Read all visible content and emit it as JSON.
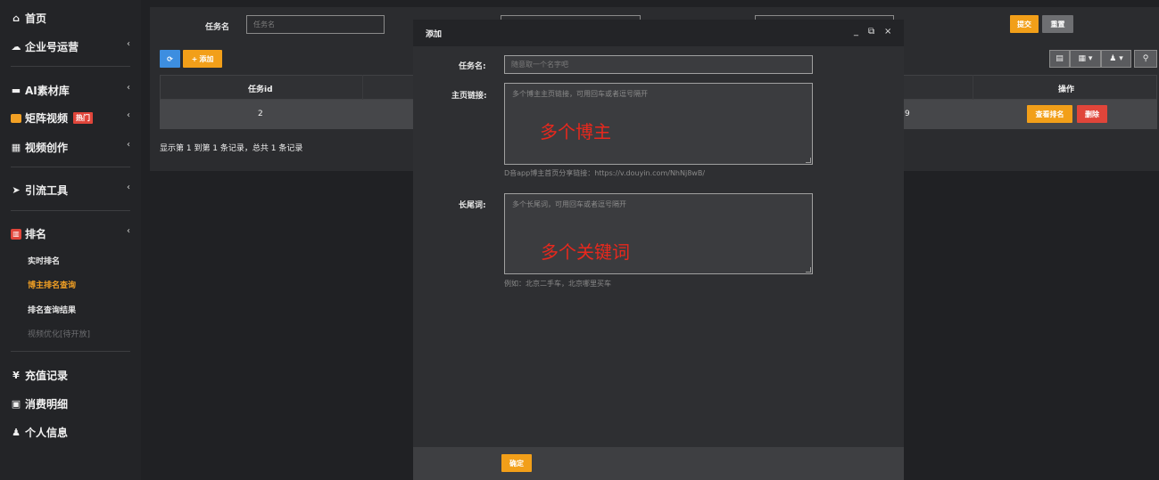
{
  "sidebar": {
    "home": "首页",
    "enterprise": "企业号运营",
    "ai_assets": "AI素材库",
    "matrix_video": "矩阵视频",
    "hot_badge": "热门",
    "video_create": "视频创作",
    "traffic_tools": "引流工具",
    "ranking": "排名",
    "sub_realtime": "实时排名",
    "sub_blogger": "博主排名查询",
    "sub_results": "排名查询结果",
    "sub_optimize": "视频优化[待开放]",
    "recharge": "充值记录",
    "consumption": "消费明细",
    "profile": "个人信息"
  },
  "search": {
    "task_label": "任务名",
    "task_placeholder": "任务名",
    "submit": "提交",
    "reset": "重置"
  },
  "toolbar": {
    "add": "添加"
  },
  "table": {
    "col_id": "任务id",
    "col_ops": "操作",
    "row_id": "2",
    "row_partial": "9",
    "view_rank": "查看排名",
    "delete": "删除",
    "pagination": "显示第 1 到第 1 条记录，总共 1 条记录"
  },
  "modal": {
    "title": "添加",
    "task_label": "任务名:",
    "task_placeholder": "随意取一个名字吧",
    "home_link_label": "主页链接:",
    "home_link_placeholder": "多个博主主页链接，可用回车或者逗号隔开",
    "home_link_annotation": "多个博主",
    "home_link_hint": "D音app博主首页分享链接：https://v.douyin.com/NhNj8wB/",
    "longtail_label": "长尾词:",
    "longtail_placeholder": "多个长尾词，可用回车或者逗号隔开",
    "longtail_annotation": "多个关键词",
    "longtail_hint": "例如：北京二手车，北京哪里买车",
    "confirm": "确定"
  },
  "colors": {
    "accent_orange": "#f29f19",
    "danger_red": "#e0453a",
    "info_blue": "#3d8ee0"
  }
}
